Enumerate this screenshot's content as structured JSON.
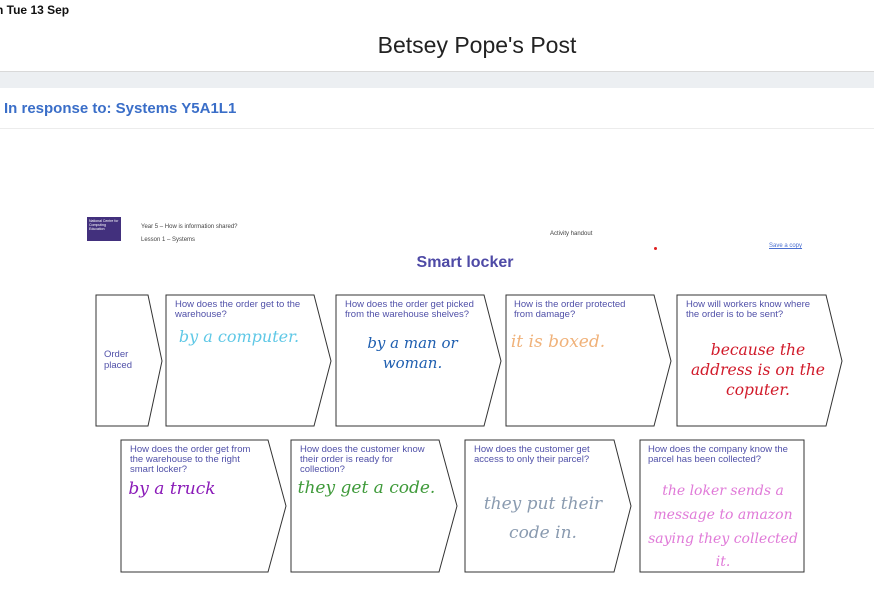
{
  "status": {
    "time": "n   Tue 13 Sep"
  },
  "post": {
    "title": "Betsey Pope's Post",
    "response_to": "In response to: Systems Y5A1L1"
  },
  "handout": {
    "logo_text": "National Centre for Computing Education",
    "year_line": "Year 5 – How is information shared?",
    "lesson_line": "Lesson 1 – Systems",
    "activity_label": "Activity handout",
    "save_copy": "Save a copy",
    "title": "Smart locker",
    "start_label": "Order placed",
    "colors": {
      "title": "#4e4aa6",
      "question": "#5050a8",
      "accent": "#3a6ec8"
    },
    "row1": [
      {
        "question": "How does the order get to the warehouse?",
        "answer": "by a computer.",
        "color": "#5fc8e6"
      },
      {
        "question": "How does the order get picked from the warehouse shelves?",
        "answer": "by a man or woman.",
        "color": "#1f5fb0"
      },
      {
        "question": "How is the order protected from damage?",
        "answer": "it is boxed.",
        "color": "#f0b27a"
      },
      {
        "question": "How will workers know where the order is to be sent?",
        "answer": "because the address is on the coputer.",
        "color": "#d11a2a"
      }
    ],
    "row2": [
      {
        "question": "How does the order get from the warehouse to the right smart locker?",
        "answer": "by a truck",
        "color": "#8a1ab8"
      },
      {
        "question": "How does the customer know their order is ready for collection?",
        "answer": "they get a code.",
        "color": "#3f9a3a"
      },
      {
        "question": "How does the customer get access to only their parcel?",
        "answer": "they put their code in.",
        "color": "#8a9bb0"
      },
      {
        "question": "How does the company know the parcel has been collected?",
        "answer": "the loker sends a message to amazon saying they collected it.",
        "color": "#e07ad8"
      }
    ]
  }
}
